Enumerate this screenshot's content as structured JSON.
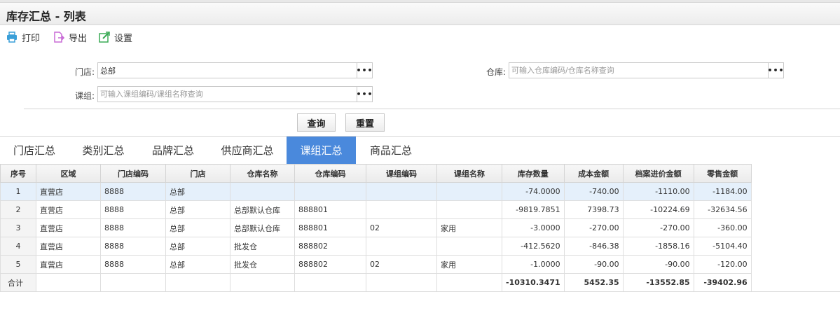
{
  "page": {
    "title": "库存汇总 - 列表"
  },
  "toolbar": {
    "print_label": "打印",
    "export_label": "导出",
    "settings_label": "设置",
    "colors": {
      "print": "#3a9fd8",
      "export": "#c86bd6",
      "settings": "#3aaa55"
    }
  },
  "filters": {
    "store": {
      "label": "门店:",
      "value": "总部",
      "placeholder": ""
    },
    "warehouse": {
      "label": "仓库:",
      "value": "",
      "placeholder": "可输入仓库编码/仓库名称查询"
    },
    "group": {
      "label": "课组:",
      "value": "",
      "placeholder": "可输入课组编码/课组名称查询"
    },
    "more_label": "•••"
  },
  "buttons": {
    "query_label": "查询",
    "reset_label": "重置"
  },
  "tabs": [
    {
      "label": "门店汇总",
      "active": false
    },
    {
      "label": "类别汇总",
      "active": false
    },
    {
      "label": "品牌汇总",
      "active": false
    },
    {
      "label": "供应商汇总",
      "active": false
    },
    {
      "label": "课组汇总",
      "active": true
    },
    {
      "label": "商品汇总",
      "active": false
    }
  ],
  "accent_color": "#4a89dc",
  "table": {
    "columns": [
      "序号",
      "区域",
      "门店编码",
      "门店",
      "仓库名称",
      "仓库编码",
      "课组编码",
      "课组名称",
      "库存数量",
      "成本金额",
      "档案进价金额",
      "零售金额"
    ],
    "rows": [
      [
        "1",
        "直营店",
        "8888",
        "总部",
        "",
        "",
        "",
        "",
        "-74.0000",
        "-740.00",
        "-1110.00",
        "-1184.00"
      ],
      [
        "2",
        "直营店",
        "8888",
        "总部",
        "总部默认仓库",
        "888801",
        "",
        "",
        "-9819.7851",
        "7398.73",
        "-10224.69",
        "-32634.56"
      ],
      [
        "3",
        "直营店",
        "8888",
        "总部",
        "总部默认仓库",
        "888801",
        "02",
        "家用",
        "-3.0000",
        "-270.00",
        "-270.00",
        "-360.00"
      ],
      [
        "4",
        "直营店",
        "8888",
        "总部",
        "批发仓",
        "888802",
        "",
        "",
        "-412.5620",
        "-846.38",
        "-1858.16",
        "-5104.40"
      ],
      [
        "5",
        "直营店",
        "8888",
        "总部",
        "批发仓",
        "888802",
        "02",
        "家用",
        "-1.0000",
        "-90.00",
        "-90.00",
        "-120.00"
      ]
    ],
    "total": [
      "合计",
      "",
      "",
      "",
      "",
      "",
      "",
      "",
      "-10310.3471",
      "5452.35",
      "-13552.85",
      "-39402.96"
    ],
    "selected_row": 0
  }
}
